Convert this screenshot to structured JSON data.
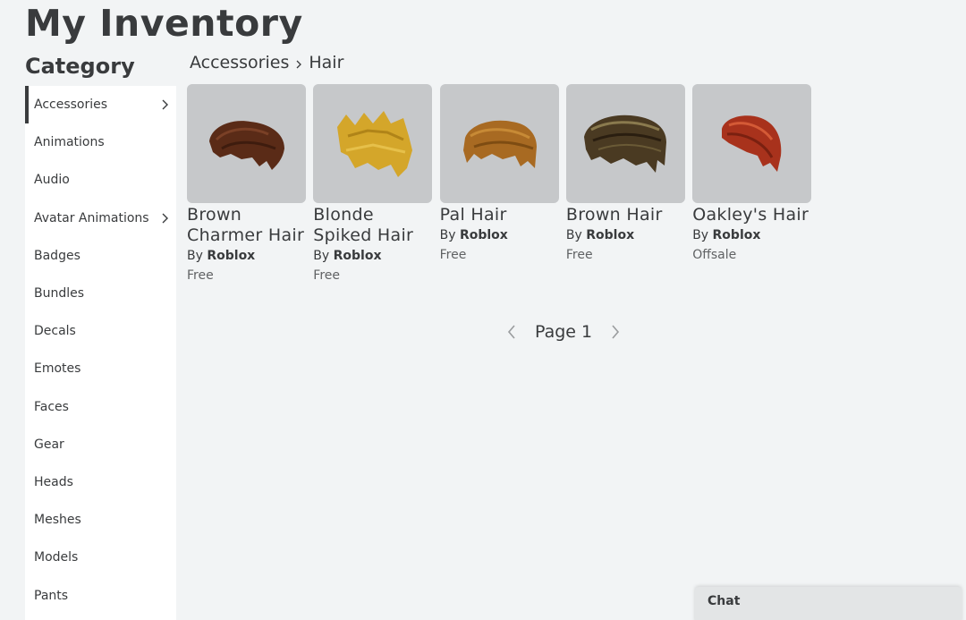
{
  "page_title": "My Inventory",
  "category_title": "Category",
  "sidebar": {
    "items": [
      {
        "label": "Accessories",
        "active": true,
        "has_chevron": true
      },
      {
        "label": "Animations"
      },
      {
        "label": "Audio"
      },
      {
        "label": "Avatar Animations",
        "has_chevron": true
      },
      {
        "label": "Badges"
      },
      {
        "label": "Bundles"
      },
      {
        "label": "Decals"
      },
      {
        "label": "Emotes"
      },
      {
        "label": "Faces"
      },
      {
        "label": "Gear"
      },
      {
        "label": "Heads"
      },
      {
        "label": "Meshes"
      },
      {
        "label": "Models"
      },
      {
        "label": "Pants"
      }
    ]
  },
  "breadcrumb": {
    "parent": "Accessories",
    "current": "Hair"
  },
  "items": [
    {
      "name": "Brown Charmer Hair",
      "by_label": "By",
      "creator": "Roblox",
      "price": "Free",
      "icon": "brown-hair-icon",
      "color": "#5a2b17"
    },
    {
      "name": "Blonde Spiked Hair",
      "by_label": "By",
      "creator": "Roblox",
      "price": "Free",
      "icon": "blonde-hair-icon",
      "color": "#d4a62a"
    },
    {
      "name": "Pal Hair",
      "by_label": "By",
      "creator": "Roblox",
      "price": "Free",
      "icon": "pal-hair-icon",
      "color": "#a86a22"
    },
    {
      "name": "Brown Hair",
      "by_label": "By",
      "creator": "Roblox",
      "price": "Free",
      "icon": "brown-hair-icon",
      "color": "#4a3a22"
    },
    {
      "name": "Oakley's Hair",
      "by_label": "By",
      "creator": "Roblox",
      "price": "Offsale",
      "icon": "red-hair-icon",
      "color": "#a8321c"
    }
  ],
  "pager": {
    "label": "Page 1"
  },
  "chat": {
    "label": "Chat"
  }
}
